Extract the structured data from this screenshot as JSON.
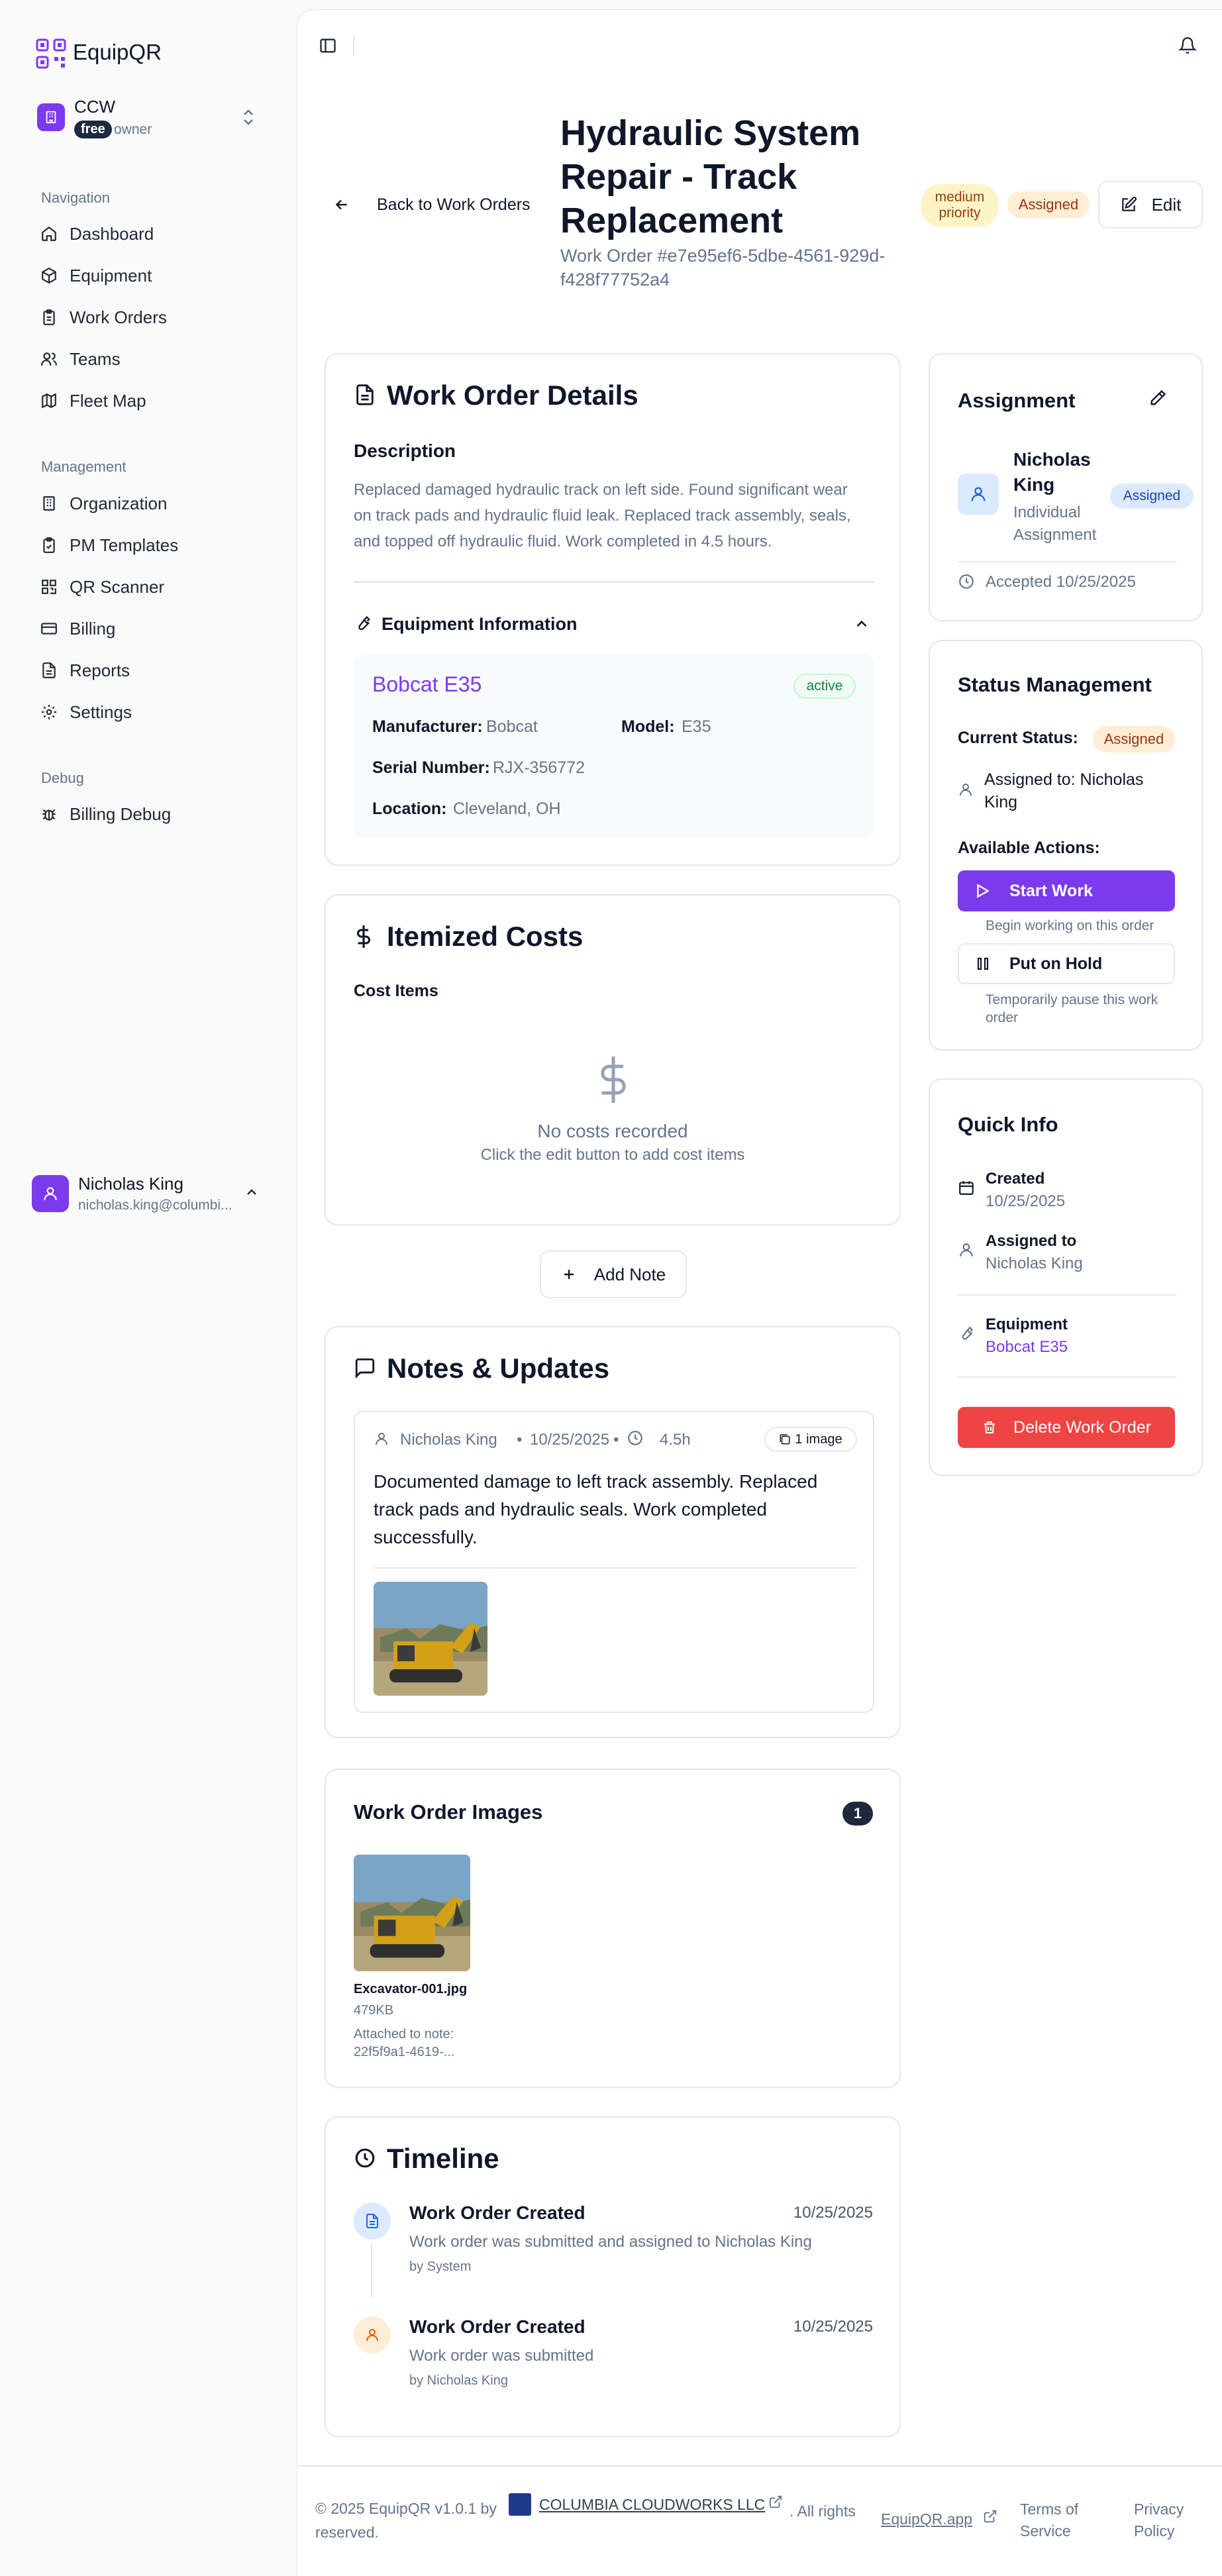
{
  "app": {
    "name": "EquipQR"
  },
  "org": {
    "name": "CCW",
    "plan": "free",
    "role": "owner"
  },
  "nav": {
    "group_navigation": "Navigation",
    "items": [
      {
        "label": "Dashboard",
        "icon": "home-icon"
      },
      {
        "label": "Equipment",
        "icon": "package-icon"
      },
      {
        "label": "Work Orders",
        "icon": "clipboard-icon"
      },
      {
        "label": "Teams",
        "icon": "users-icon"
      },
      {
        "label": "Fleet Map",
        "icon": "map-icon"
      }
    ],
    "group_management": "Management",
    "management": [
      {
        "label": "Organization",
        "icon": "building-icon"
      },
      {
        "label": "PM Templates",
        "icon": "clipboard-check-icon"
      },
      {
        "label": "QR Scanner",
        "icon": "qr-icon"
      },
      {
        "label": "Billing",
        "icon": "credit-card-icon"
      },
      {
        "label": "Reports",
        "icon": "file-icon"
      },
      {
        "label": "Settings",
        "icon": "gear-icon"
      }
    ],
    "group_debug": "Debug",
    "debug": [
      {
        "label": "Billing Debug",
        "icon": "bug-icon"
      }
    ]
  },
  "user": {
    "name": "Nicholas King",
    "email": "nicholas.king@columbi..."
  },
  "header": {
    "back": "Back to Work Orders",
    "title_lines": [
      "Hydraulic System",
      "Repair - Track",
      "Replacement"
    ],
    "subtitle_lines": [
      "Work Order #e7e95ef6-5dbe-4561-929d-",
      "f428f77752a4"
    ],
    "priority_lines": [
      "medium",
      "priority"
    ],
    "status": "Assigned",
    "edit": "Edit"
  },
  "details": {
    "title": "Work Order Details",
    "desc_label": "Description",
    "desc_lines": [
      "Replaced damaged hydraulic track on left side. Found significant wear",
      "on track pads and hydraulic fluid leak. Replaced track assembly, seals,",
      "and topped off hydraulic fluid. Work completed in 4.5 hours."
    ],
    "equip_section": "Equipment Information",
    "equip_name": "Bobcat E35",
    "equip_status": "active",
    "manufacturer_label": "Manufacturer:",
    "manufacturer": "Bobcat",
    "model_label": "Model:",
    "model": "E35",
    "serial_label": "Serial Number:",
    "serial": "RJX-356772",
    "location_label": "Location:",
    "location": "Cleveland, OH"
  },
  "costs": {
    "title": "Itemized Costs",
    "items_label": "Cost Items",
    "empty": "No costs recorded",
    "hint": "Click the edit button to add cost items"
  },
  "add_note": "Add Note",
  "notes": {
    "title": "Notes & Updates",
    "author": "Nicholas King",
    "date": "10/25/2025",
    "hours": "4.5h",
    "images": "1 image",
    "text_lines": [
      "Documented damage to left track assembly. Replaced",
      "track pads and hydraulic seals. Work completed",
      "successfully."
    ]
  },
  "images": {
    "title": "Work Order Images",
    "count": "1",
    "file": "Excavator-001.jpg",
    "size": "479KB",
    "attached_lines": [
      "Attached to note:",
      "22f5f9a1-4619-..."
    ]
  },
  "timeline": {
    "title": "Timeline",
    "events": [
      {
        "title": "Work Order Created",
        "date": "10/25/2025",
        "desc": "Work order was submitted and assigned to Nicholas King",
        "by": "by System"
      },
      {
        "title": "Work Order Created",
        "date": "10/25/2025",
        "desc": "Work order was submitted",
        "by": "by Nicholas King"
      }
    ]
  },
  "assignment": {
    "title": "Assignment",
    "name_lines": [
      "Nicholas",
      "King"
    ],
    "type_lines": [
      "Individual",
      "Assignment"
    ],
    "badge": "Assigned",
    "accepted": "Accepted 10/25/2025"
  },
  "status_mgmt": {
    "title": "Status Management",
    "current_label": "Current Status:",
    "current": "Assigned",
    "assigned_lines": [
      "Assigned to: Nicholas",
      "King"
    ],
    "actions_label": "Available Actions:",
    "start": "Start Work",
    "start_hint": "Begin working on this order",
    "hold": "Put on Hold",
    "hold_hint_lines": [
      "Temporarily pause this work",
      "order"
    ]
  },
  "quick": {
    "title": "Quick Info",
    "created_label": "Created",
    "created": "10/25/2025",
    "assigned_label": "Assigned to",
    "assigned": "Nicholas King",
    "equipment_label": "Equipment",
    "equipment": "Bobcat E35",
    "delete": "Delete Work Order"
  },
  "footer": {
    "copy": "© 2025 EquipQR v1.0.1 by",
    "company": "COLUMBIA CLOUDWORKS LLC",
    "rights": ". All rights",
    "reserved": "reserved.",
    "site": "EquipQR.app",
    "terms_lines": [
      "Terms of",
      "Service"
    ],
    "privacy_lines": [
      "Privacy",
      "Policy"
    ]
  },
  "colors": {
    "accent": "#7c3aed",
    "danger": "#ef4444",
    "navy": "#1e293b"
  }
}
